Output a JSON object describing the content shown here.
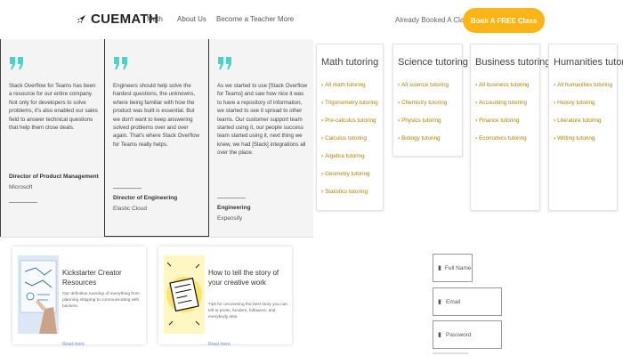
{
  "nav": {
    "brand": "CUEMATH",
    "links": [
      "Math",
      "About Us",
      "Become a Teacher",
      "More"
    ],
    "already_booked": "Already Booked A Class?",
    "cta": "Book A FREE Class",
    "accent_color": "#fdb515"
  },
  "testimonials": [
    {
      "body": "Stack Overflow for Teams has been a resource for our entire company. Not only for developers to solve problems, it's also enabled our sales field to answer technical questions that help them close deals.",
      "role": "Director of Product Management",
      "company": "Microsoft"
    },
    {
      "body": "Engineers should help solve the hardest questions, the unknowns, where being familiar with how the product was built is essential. But we don't want to keep answering solved problems over and over again. That's where Stack Overflow for Teams really helps.",
      "role": "Director of Engineering",
      "company": "Elastic Cloud"
    },
    {
      "body": "As we started to use [Stack Overflow for Teams] and saw how nice it was to have a repository of information, we started to see it spread to other teams. Our customer support team started using it, our people success team started using it, next thing we knew, we had [Slack] integrations all over the place.",
      "role": "Engineering",
      "company": "Expensify"
    }
  ],
  "quote_icon": "quote-icon",
  "quote_color": "#4fd1c5",
  "tutoring": [
    {
      "title": "Math tutoring",
      "items": [
        "All math tutoring",
        "Trigonometry tutoring",
        "Pre-calculus tutoring",
        "Calculus tutoring",
        "Algebra tutoring",
        "Geometry tutoring",
        "Statistics tutoring"
      ]
    },
    {
      "title": "Science tutoring",
      "items": [
        "All science tutoring",
        "Chemistry tutoring",
        "Physics tutoring",
        "Biology tutoring"
      ]
    },
    {
      "title": "Business tutoring",
      "items": [
        "All business tutoring",
        "Accounting tutoring",
        "Finance tutoring",
        "Economics tutoring"
      ]
    },
    {
      "title": "Humanities tutoring",
      "items": [
        "All humanities tutoring",
        "History tutoring",
        "Literature tutoring",
        "Writing tutoring"
      ]
    }
  ],
  "link_color": "#b08000",
  "resources": [
    {
      "title": "Kickstarter Creator Resources",
      "desc": "Our definitive roundup of everything from planning shipping to communicating with backers.",
      "more": "Read more"
    },
    {
      "title": "How to tell the story of your creative work",
      "desc": "Tips for uncovering the best story you can tell to press, funders, followers, and everybody else.",
      "more": "Read more"
    }
  ],
  "form": {
    "full_name": "Full Name",
    "email": "Email",
    "password": "Password"
  }
}
